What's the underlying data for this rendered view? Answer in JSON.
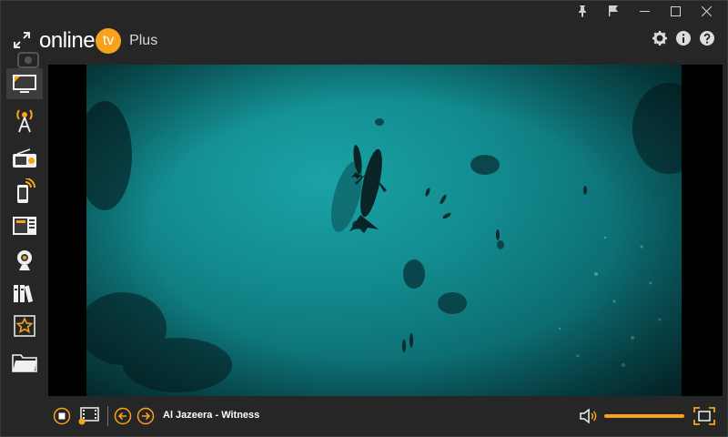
{
  "app": {
    "logo_text": "online",
    "logo_badge": "tv",
    "edition": "Plus"
  },
  "window_controls": {
    "pin": "pin-icon",
    "flag": "flag-icon",
    "minimize": "minimize-icon",
    "maximize": "maximize-icon",
    "close": "close-icon"
  },
  "header_tools": [
    "gear-icon",
    "info-icon",
    "help-icon"
  ],
  "sidebar": {
    "items": [
      {
        "name": "tv-icon",
        "active": true
      },
      {
        "name": "broadcast-tower-icon",
        "active": false
      },
      {
        "name": "radio-icon",
        "active": false
      },
      {
        "name": "mobile-stream-icon",
        "active": false
      },
      {
        "name": "tv-guide-icon",
        "active": false
      },
      {
        "name": "webcam-icon",
        "active": false
      },
      {
        "name": "library-icon",
        "active": false
      },
      {
        "name": "favorites-star-icon",
        "active": false
      },
      {
        "name": "folder-icon",
        "active": false
      }
    ]
  },
  "player": {
    "now_playing": "Al Jazeera - Witness",
    "volume_level": 1.0
  },
  "colors": {
    "accent": "#f7a21b",
    "background": "#262626",
    "video_water": "#128a8e"
  }
}
